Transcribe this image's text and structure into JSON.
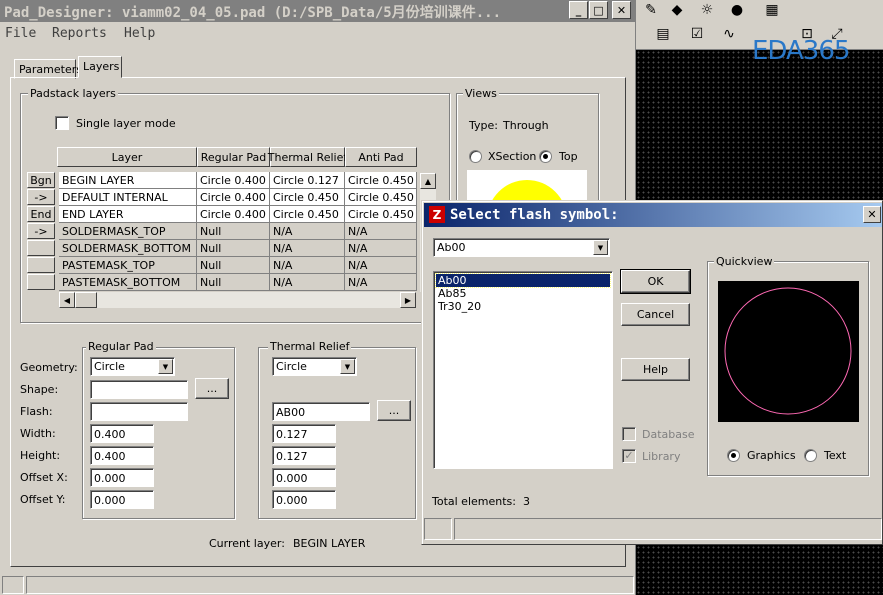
{
  "main_window": {
    "title": "Pad_Designer: viamm02_04_05.pad (D:/SPB_Data/5月份培训课件...",
    "menu": [
      "File",
      "Reports",
      "Help"
    ],
    "tabs": [
      "Parameters",
      "Layers"
    ],
    "active_tab": "Layers"
  },
  "padstack": {
    "group_title": "Padstack layers",
    "single_layer_mode_label": "Single layer mode",
    "columns": [
      "Layer",
      "Regular Pad",
      "Thermal Relief",
      "Anti Pad"
    ],
    "rows": [
      {
        "btn": "Bgn",
        "layer": "BEGIN LAYER",
        "regular": "Circle 0.400",
        "thermal": "Circle 0.127",
        "anti": "Circle 0.450"
      },
      {
        "btn": "->",
        "layer": "DEFAULT INTERNAL",
        "regular": "Circle 0.400",
        "thermal": "Circle 0.450",
        "anti": "Circle 0.450"
      },
      {
        "btn": "End",
        "layer": "END LAYER",
        "regular": "Circle 0.400",
        "thermal": "Circle 0.450",
        "anti": "Circle 0.450"
      },
      {
        "btn": "->",
        "layer": "SOLDERMASK_TOP",
        "regular": "Null",
        "thermal": "N/A",
        "anti": "N/A"
      },
      {
        "btn": "",
        "layer": "SOLDERMASK_BOTTOM",
        "regular": "Null",
        "thermal": "N/A",
        "anti": "N/A"
      },
      {
        "btn": "",
        "layer": "PASTEMASK_TOP",
        "regular": "Null",
        "thermal": "N/A",
        "anti": "N/A"
      },
      {
        "btn": "",
        "layer": "PASTEMASK_BOTTOM",
        "regular": "Null",
        "thermal": "N/A",
        "anti": "N/A"
      }
    ]
  },
  "views": {
    "group_title": "Views",
    "type_label": "Type:",
    "type_value": "Through",
    "xsection_label": "XSection",
    "top_label": "Top"
  },
  "regular_pad": {
    "group_title": "Regular Pad",
    "geometry": "Circle",
    "shape": "",
    "flash": "",
    "width": "0.400",
    "height": "0.400",
    "offset_x": "0.000",
    "offset_y": "0.000"
  },
  "thermal_relief": {
    "group_title": "Thermal Relief",
    "geometry": "Circle",
    "flash": "AB00",
    "width": "0.127",
    "height": "0.127",
    "offset_x": "0.000",
    "offset_y": "0.000"
  },
  "field_labels": {
    "geometry": "Geometry:",
    "shape": "Shape:",
    "flash": "Flash:",
    "width": "Width:",
    "height": "Height:",
    "offset_x": "Offset X:",
    "offset_y": "Offset Y:"
  },
  "browse_label": "...",
  "current_layer_label": "Current layer:",
  "current_layer_value": "BEGIN LAYER",
  "dialog": {
    "title": "Select flash symbol:",
    "combo_value": "Ab00",
    "items": [
      "Ab00",
      "Ab85",
      "Tr30_20"
    ],
    "ok_label": "OK",
    "cancel_label": "Cancel",
    "help_label": "Help",
    "database_label": "Database",
    "library_label": "Library",
    "quickview_title": "Quickview",
    "graphics_label": "Graphics",
    "text_label": "Text",
    "total_label": "Total elements:",
    "total_value": "3"
  },
  "logo_text": "EDA365",
  "colors": {
    "selection": "#0a246a",
    "preview_circle": "#ff69b4",
    "views_pad": "#ffff00",
    "logo": "#2a78c8"
  }
}
